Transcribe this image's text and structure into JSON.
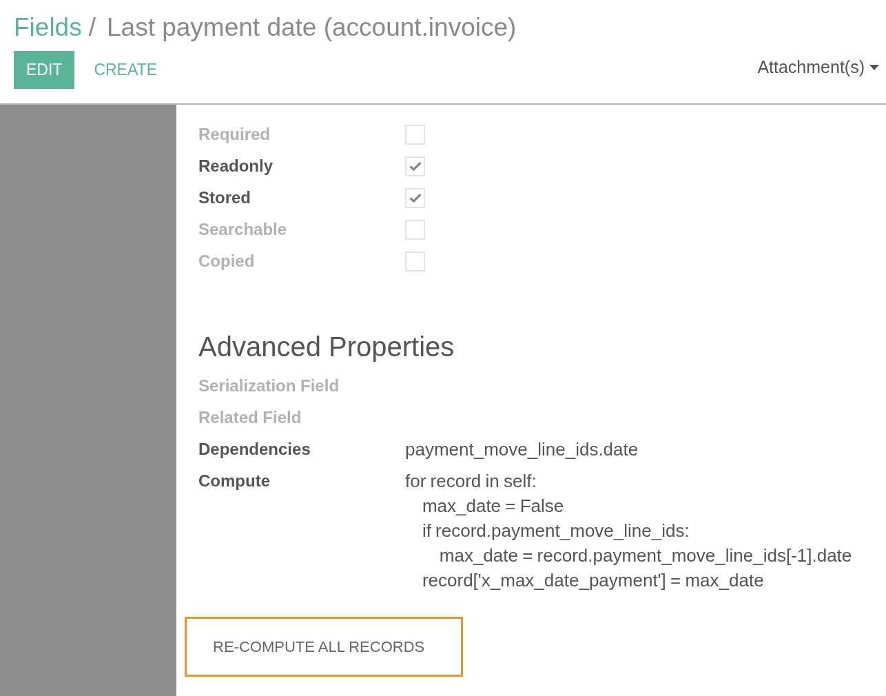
{
  "breadcrumb": {
    "items": [
      {
        "label": "Fields",
        "kind": "link"
      },
      {
        "label": "Last payment date (account.invoice)",
        "kind": "current"
      }
    ],
    "separator": "/"
  },
  "toolbar": {
    "buttons": [
      {
        "label": "EDIT",
        "kind": "primary"
      },
      {
        "label": "CREATE",
        "kind": "link"
      }
    ],
    "attachments": {
      "label": "Attachment(s)"
    }
  },
  "properties": [
    {
      "label": "Required",
      "checked": false
    },
    {
      "label": "Readonly",
      "checked": true
    },
    {
      "label": "Stored",
      "checked": true
    },
    {
      "label": "Searchable",
      "checked": false
    },
    {
      "label": "Copied",
      "checked": false
    }
  ],
  "advanced": {
    "title": "Advanced Properties",
    "fields": [
      {
        "label": "Serialization Field",
        "kind": "empty"
      },
      {
        "label": "Related Field",
        "kind": "empty"
      },
      {
        "label": "Dependencies",
        "kind": "text",
        "value": "payment_move_line_ids.date"
      },
      {
        "label": "Compute",
        "kind": "code",
        "value": "for record in self:\n    max_date = False\n    if record.payment_move_line_ids:\n        max_date = record.payment_move_line_ids[-1].date\n    record['x_max_date_payment'] = max_date"
      }
    ]
  },
  "recompute_button": {
    "label": "RE-COMPUTE ALL RECORDS",
    "highlighted": true
  }
}
